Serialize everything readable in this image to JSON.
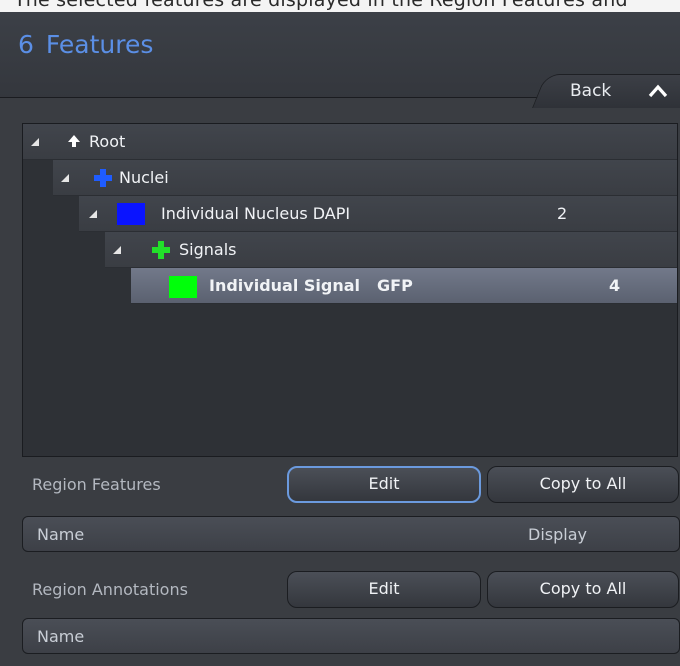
{
  "top_strip": {
    "text": "The selected features are displayed in the Region Features and"
  },
  "header": {
    "number": "6",
    "title": "Features"
  },
  "back_tab": {
    "label": "Back"
  },
  "tree": {
    "root_label": "Root",
    "nuclei_label": "Nuclei",
    "nucleus_label": "Individual Nucleus DAPI",
    "nucleus_count": "2",
    "signals_label": "Signals",
    "signal_label": "Individual Signal",
    "signal_channel": "GFP",
    "signal_count": "4"
  },
  "region_features": {
    "label": "Region Features",
    "edit": "Edit",
    "copy_all": "Copy to All",
    "col_name": "Name",
    "col_display": "Display"
  },
  "region_annotations": {
    "label": "Region Annotations",
    "edit": "Edit",
    "copy_all": "Copy to All",
    "col_name": "Name"
  },
  "colors": {
    "accent": "#5b8fe6",
    "nuclei_plus": "#1f5cff",
    "signals_plus": "#22e02a",
    "nucleus_swatch": "#0a14ff",
    "signal_swatch": "#00ff0a"
  },
  "icons": [
    "collapse-up-icon",
    "expand-triangle-icon",
    "root-arrow-icon",
    "plus-icon"
  ]
}
